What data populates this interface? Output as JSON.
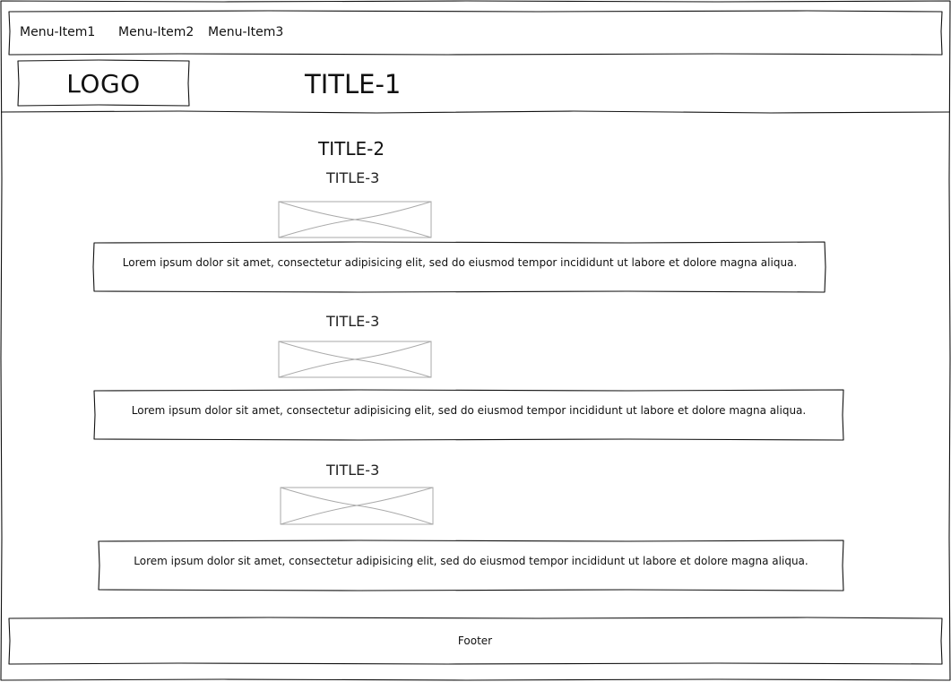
{
  "header": {
    "menu": [
      {
        "label": "Menu-Item1"
      },
      {
        "label": "Menu-Item2"
      },
      {
        "label": "Menu-Item3"
      }
    ],
    "logo": "LOGO",
    "title": "TITLE-1"
  },
  "main": {
    "title": "TITLE-2",
    "sections": [
      {
        "title": "TITLE-3",
        "text": "Lorem ipsum dolor sit amet, consectetur adipisicing elit, sed do eiusmod tempor incididunt ut labore et dolore magna aliqua."
      },
      {
        "title": "TITLE-3",
        "text": "Lorem ipsum dolor sit amet, consectetur adipisicing elit, sed do eiusmod tempor incididunt ut labore et dolore magna aliqua."
      },
      {
        "title": "TITLE-3",
        "text": "Lorem ipsum dolor sit amet, consectetur adipisicing elit, sed do eiusmod tempor incididunt ut labore et dolore magna aliqua."
      }
    ]
  },
  "footer": {
    "label": "Footer"
  },
  "colors": {
    "stroke": "#111111",
    "placeholder_stroke": "#aaaaaa",
    "background": "#ffffff"
  }
}
